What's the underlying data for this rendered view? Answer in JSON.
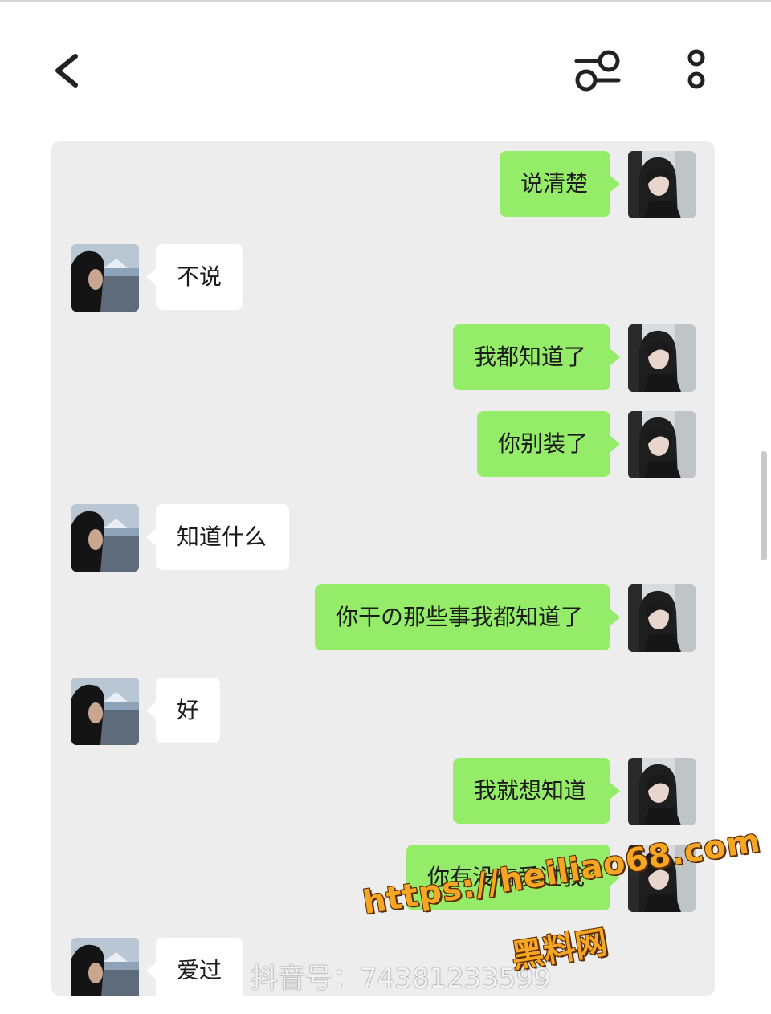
{
  "header": {
    "back_icon": "chevron-left-icon",
    "filter_icon": "sliders-icon",
    "more_icon": "more-vertical-icon"
  },
  "messages": [
    {
      "side": "right",
      "text": "说清楚"
    },
    {
      "side": "left",
      "text": "不说"
    },
    {
      "side": "right",
      "text": "我都知道了"
    },
    {
      "side": "right",
      "text": "你别装了"
    },
    {
      "side": "left",
      "text": "知道什么"
    },
    {
      "side": "right",
      "text": "你干の那些事我都知道了"
    },
    {
      "side": "left",
      "text": "好"
    },
    {
      "side": "right",
      "text": "我就想知道"
    },
    {
      "side": "right",
      "text": "你有没有爱过我"
    },
    {
      "side": "left",
      "text": "爱过"
    }
  ],
  "watermarks": {
    "douyin_label": "抖音号：74381233599",
    "site_url": "https://heiliao68.com",
    "site_name": "黑料网"
  },
  "colors": {
    "outgoing_bubble": "#95ec69",
    "incoming_bubble": "#ffffff",
    "chat_background": "#ededed"
  }
}
